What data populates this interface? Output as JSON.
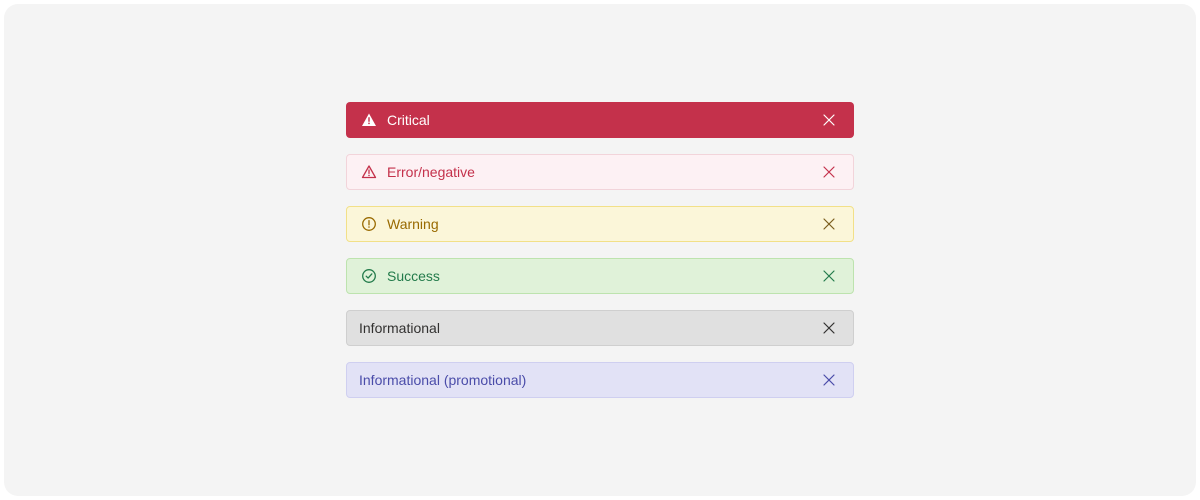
{
  "banners": [
    {
      "variant": "critical",
      "label": "Critical",
      "icon": "warning-triangle-filled",
      "dismissible": true
    },
    {
      "variant": "error",
      "label": "Error/negative",
      "icon": "warning-triangle",
      "dismissible": true
    },
    {
      "variant": "warning",
      "label": "Warning",
      "icon": "exclamation-circle",
      "dismissible": true
    },
    {
      "variant": "success",
      "label": "Success",
      "icon": "checkmark-circle",
      "dismissible": true
    },
    {
      "variant": "info",
      "label": "Informational",
      "icon": null,
      "dismissible": true
    },
    {
      "variant": "promo",
      "label": "Informational (promotional)",
      "icon": null,
      "dismissible": true
    }
  ],
  "colors": {
    "critical_bg": "#c4314b",
    "error_bg": "#fdf1f4",
    "error_fg": "#c4314b",
    "warning_bg": "#fbf6d9",
    "warning_fg": "#996a00",
    "success_bg": "#e0f2d9",
    "success_fg": "#237b4b",
    "info_bg": "#e0e0e0",
    "info_fg": "#323130",
    "promo_bg": "#e2e2f6",
    "promo_fg": "#4a4ca9",
    "canvas_bg": "#f4f4f4"
  }
}
